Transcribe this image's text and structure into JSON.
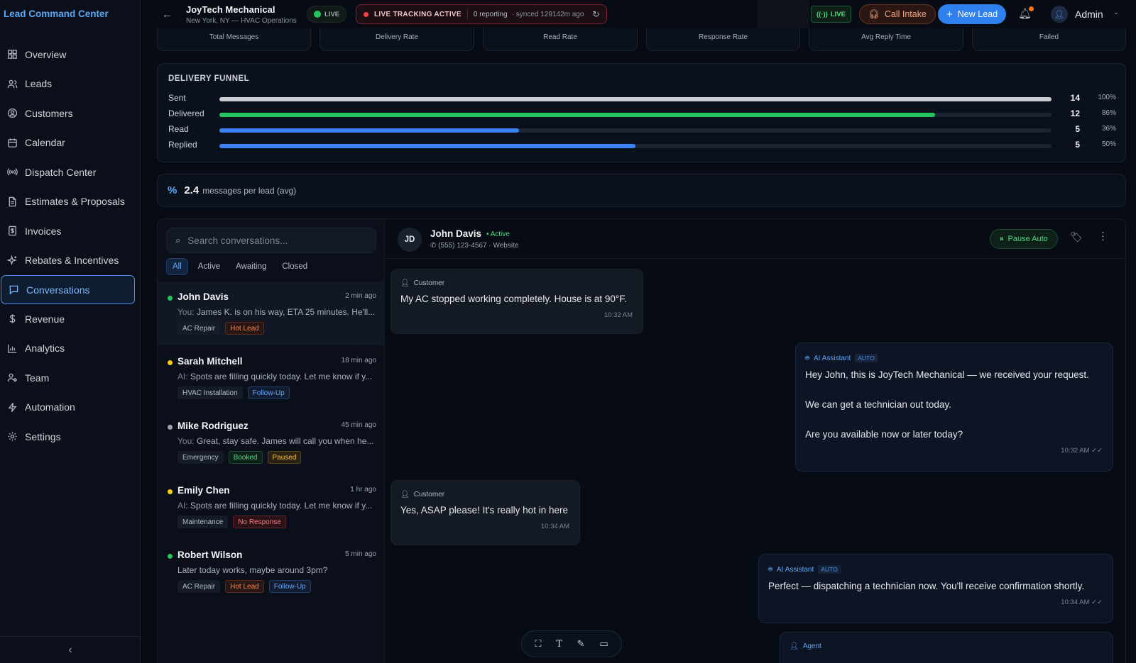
{
  "brand": "Lead Command Center",
  "nav": [
    {
      "label": "Overview",
      "icon": "grid-icon"
    },
    {
      "label": "Leads",
      "icon": "users-icon"
    },
    {
      "label": "Customers",
      "icon": "user-circle-icon"
    },
    {
      "label": "Calendar",
      "icon": "calendar-icon"
    },
    {
      "label": "Dispatch Center",
      "icon": "radio-icon"
    },
    {
      "label": "Estimates & Proposals",
      "icon": "document-icon"
    },
    {
      "label": "Invoices",
      "icon": "receipt-icon"
    },
    {
      "label": "Rebates & Incentives",
      "icon": "sparkle-icon"
    },
    {
      "label": "Conversations",
      "icon": "chat-icon"
    },
    {
      "label": "Revenue",
      "icon": "dollar-icon"
    },
    {
      "label": "Analytics",
      "icon": "bar-chart-icon"
    },
    {
      "label": "Team",
      "icon": "team-icon"
    },
    {
      "label": "Automation",
      "icon": "bolt-icon"
    },
    {
      "label": "Settings",
      "icon": "gear-icon"
    }
  ],
  "header": {
    "company": "JoyTech Mechanical",
    "location": "New York, NY — HVAC Operations",
    "live_label": "LIVE",
    "tracking_label": "LIVE TRACKING ACTIVE",
    "reporting": "0 reporting",
    "synced": "· synced 129142m ago",
    "live2_label": "LIVE",
    "call_intake": "Call Intake",
    "new_lead": "New Lead",
    "admin": "Admin"
  },
  "stats": [
    "Total Messages",
    "Delivery Rate",
    "Read Rate",
    "Response Rate",
    "Avg Reply Time",
    "Failed"
  ],
  "funnel": {
    "title": "DELIVERY FUNNEL",
    "rows": [
      {
        "label": "Sent",
        "count": "14",
        "pct": "100%",
        "fraction": 1.0,
        "color": "#c9ccd1"
      },
      {
        "label": "Delivered",
        "count": "12",
        "pct": "86%",
        "fraction": 0.86,
        "color": "#22c55e"
      },
      {
        "label": "Read",
        "count": "5",
        "pct": "36%",
        "fraction": 0.36,
        "color": "#3b82f6"
      },
      {
        "label": "Replied",
        "count": "5",
        "pct": "50%",
        "fraction": 0.5,
        "color": "#3b82f6"
      }
    ]
  },
  "avg": {
    "value": "2.4",
    "label": "messages per lead (avg)"
  },
  "conversations_list": {
    "search_placeholder": "Search conversations...",
    "filters": [
      "All",
      "Active",
      "Awaiting",
      "Closed"
    ],
    "items": [
      {
        "name": "John Davis",
        "time": "2 min ago",
        "prefix": "You:",
        "preview": "James K. is on his way, ETA 25 minutes. He'll...",
        "dot": "#22c55e",
        "tags": [
          {
            "text": "AC Repair",
            "kind": "neutral"
          },
          {
            "text": "Hot Lead",
            "kind": "hot"
          }
        ]
      },
      {
        "name": "Sarah Mitchell",
        "time": "18 min ago",
        "prefix": "AI:",
        "preview": "Spots are filling quickly today. Let me know if y...",
        "dot": "#facc15",
        "tags": [
          {
            "text": "HVAC Installation",
            "kind": "neutral"
          },
          {
            "text": "Follow-Up",
            "kind": "follow"
          }
        ]
      },
      {
        "name": "Mike Rodriguez",
        "time": "45 min ago",
        "prefix": "You:",
        "preview": "Great, stay safe. James will call you when he...",
        "dot": "#9ca3af",
        "tags": [
          {
            "text": "Emergency",
            "kind": "neutral"
          },
          {
            "text": "Booked",
            "kind": "booked"
          },
          {
            "text": "Paused",
            "kind": "paused"
          }
        ]
      },
      {
        "name": "Emily Chen",
        "time": "1 hr ago",
        "prefix": "AI:",
        "preview": "Spots are filling quickly today. Let me know if y...",
        "dot": "#facc15",
        "tags": [
          {
            "text": "Maintenance",
            "kind": "neutral"
          },
          {
            "text": "No Response",
            "kind": "noresp"
          }
        ]
      },
      {
        "name": "Robert Wilson",
        "time": "5 min ago",
        "prefix": "",
        "preview": "Later today works, maybe around 3pm?",
        "dot": "#22c55e",
        "tags": [
          {
            "text": "AC Repair",
            "kind": "neutral"
          },
          {
            "text": "Hot Lead",
            "kind": "hot"
          },
          {
            "text": "Follow-Up",
            "kind": "follow"
          }
        ]
      }
    ]
  },
  "chat": {
    "initials": "JD",
    "name": "John Davis",
    "status": "• Active",
    "sub": "(555) 123-4567 · Website",
    "pause_label": "Pause Auto",
    "messages": [
      {
        "kind": "cust",
        "who": "Customer",
        "text": "My AC stopped working completely. House is at 90°F.",
        "time": "10:32 AM"
      },
      {
        "kind": "ai",
        "who": "AI Assistant",
        "badge": "AUTO",
        "text": "Hey John, this is JoyTech Mechanical — we received your request.\n\nWe can get a technician out today.\n\nAre you available now or later today?",
        "time": "10:32 AM ✓✓"
      },
      {
        "kind": "cust",
        "who": "Customer",
        "text": "Yes, ASAP please! It's really hot in here",
        "time": "10:34 AM"
      },
      {
        "kind": "ai",
        "who": "AI Assistant",
        "badge": "AUTO",
        "text": "Perfect — dispatching a technician now. You'll receive confirmation shortly.",
        "time": "10:34 AM ✓✓"
      },
      {
        "kind": "ai",
        "who": "Agent",
        "badge": "",
        "text": "",
        "time": ""
      }
    ]
  },
  "toolbar_icons": [
    "screenshot-icon",
    "text-icon",
    "pen-icon",
    "comment-icon"
  ]
}
